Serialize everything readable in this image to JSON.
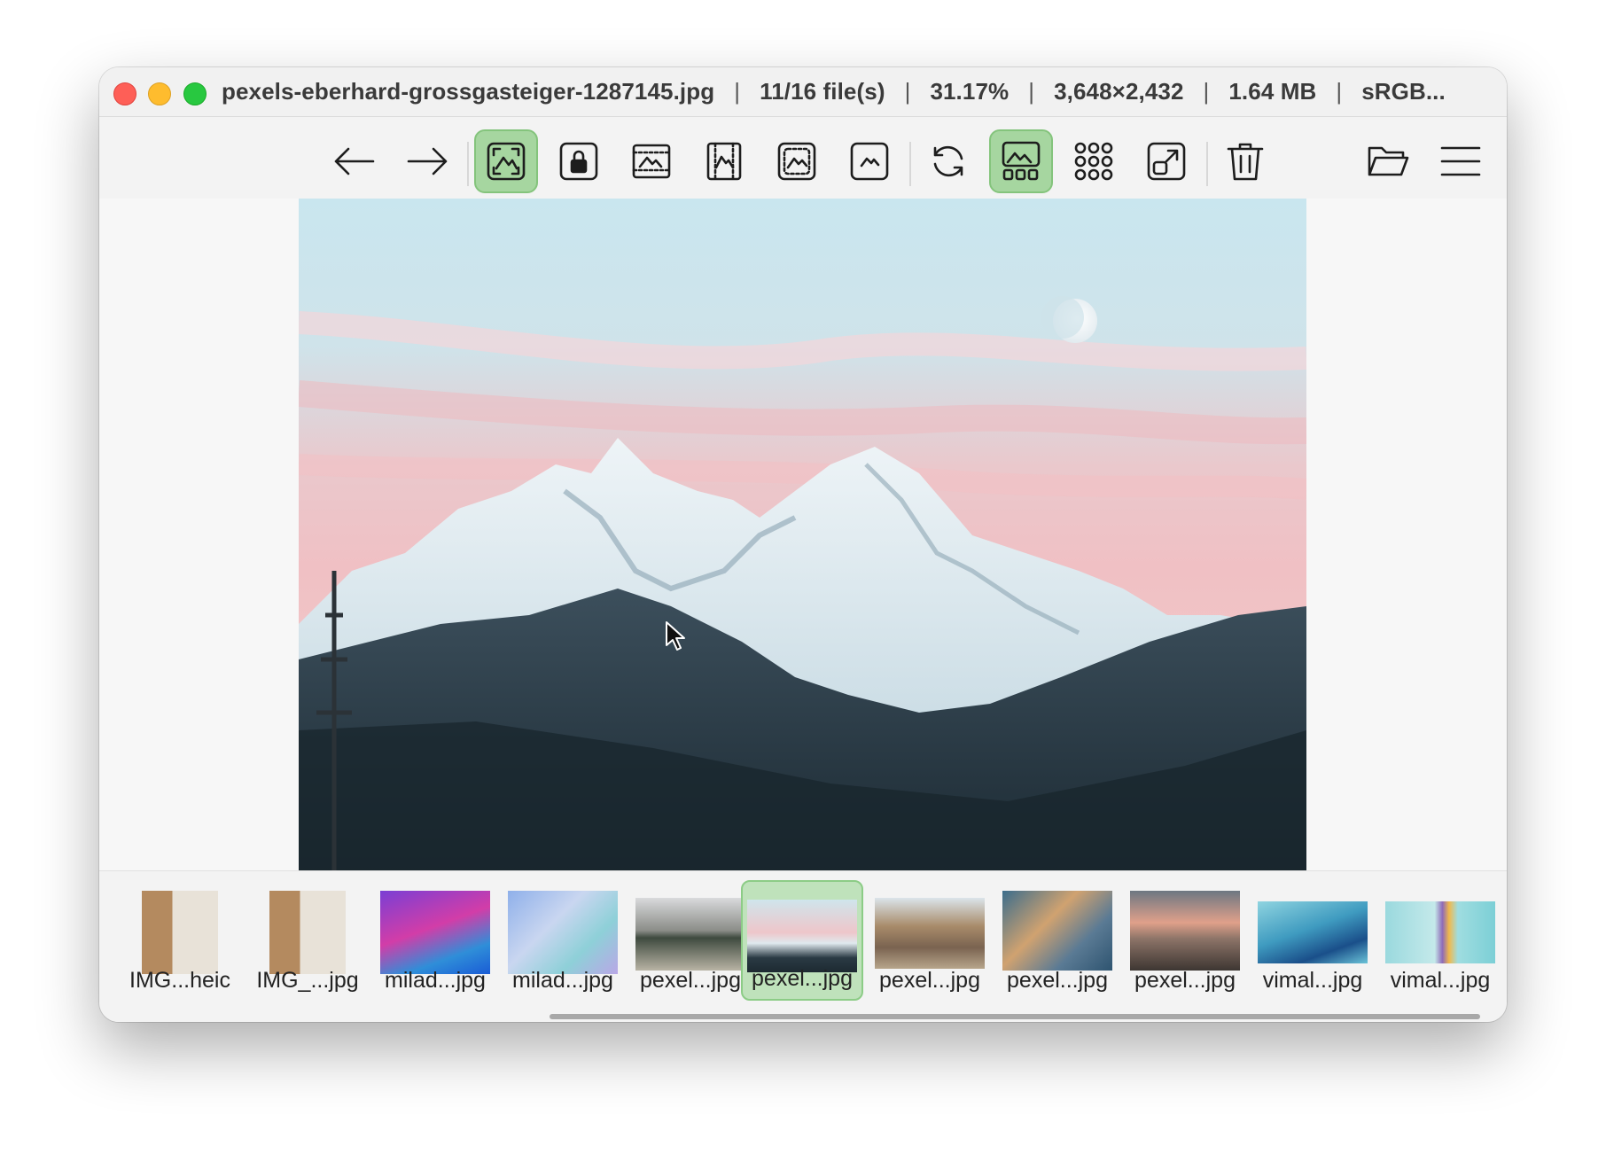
{
  "window": {
    "title_parts": [
      "pexels-eberhard-grossgasteiger-1287145.jpg",
      "11/16 file(s)",
      "31.17%",
      "3,648×2,432",
      "1.64 MB",
      "sRGB..."
    ],
    "separator": "|"
  },
  "toolbar": {
    "buttons": [
      {
        "name": "back",
        "icon": "arrow-left-icon",
        "active": false
      },
      {
        "name": "forward",
        "icon": "arrow-right-icon",
        "active": false
      },
      {
        "name": "fit-to-window",
        "icon": "fit-window-icon",
        "active": true
      },
      {
        "name": "lock-zoom",
        "icon": "lock-zoom-icon",
        "active": false
      },
      {
        "name": "fit-width",
        "icon": "fit-width-icon",
        "active": false
      },
      {
        "name": "fit-height",
        "icon": "fit-height-icon",
        "active": false
      },
      {
        "name": "autofit",
        "icon": "auto-fit-icon",
        "active": false
      },
      {
        "name": "original-size",
        "icon": "original-size-icon",
        "active": false
      },
      {
        "name": "refresh",
        "icon": "refresh-icon",
        "active": false
      },
      {
        "name": "thumbnail-bar",
        "icon": "thumbnail-bar-icon",
        "active": true
      },
      {
        "name": "gallery",
        "icon": "gallery-grid-icon",
        "active": false
      },
      {
        "name": "open-external",
        "icon": "open-external-icon",
        "active": false
      },
      {
        "name": "delete",
        "icon": "trash-icon",
        "active": false
      },
      {
        "name": "open-file",
        "icon": "folder-open-icon",
        "active": false
      },
      {
        "name": "menu",
        "icon": "hamburger-menu-icon",
        "active": false
      }
    ]
  },
  "thumbnails": [
    {
      "label": "IMG...heic",
      "selected": false
    },
    {
      "label": "IMG_...jpg",
      "selected": false
    },
    {
      "label": "milad...jpg",
      "selected": false
    },
    {
      "label": "milad...jpg",
      "selected": false
    },
    {
      "label": "pexel...jpg",
      "selected": false
    },
    {
      "label": "pexel...jpg",
      "selected": true
    },
    {
      "label": "pexel...jpg",
      "selected": false
    },
    {
      "label": "pexel...jpg",
      "selected": false
    },
    {
      "label": "pexel...jpg",
      "selected": false
    },
    {
      "label": "vimal...jpg",
      "selected": false
    },
    {
      "label": "vimal...jpg",
      "selected": false
    }
  ],
  "colors": {
    "accent": "#a6d6a0",
    "accent_border": "#84c47c"
  }
}
